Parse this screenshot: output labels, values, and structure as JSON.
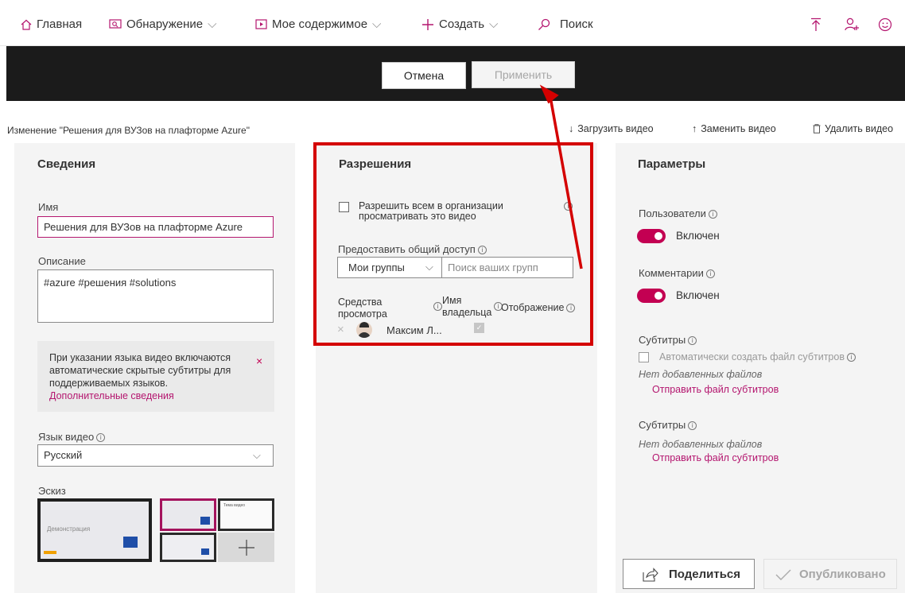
{
  "nav": {
    "home": "Главная",
    "discover": "Обнаружение",
    "my_content": "Мое содержимое",
    "create": "Создать",
    "search": "Поиск"
  },
  "actions": {
    "cancel": "Отмена",
    "apply": "Применить"
  },
  "toolbar": {
    "title": "Изменение \"Решения для ВУЗов на плафторме Azure\"",
    "upload": "Загрузить видео",
    "replace": "Заменить видео",
    "delete": "Удалить видео"
  },
  "details": {
    "header": "Сведения",
    "name_label": "Имя",
    "name_value": "Решения для ВУЗов на плафторме Azure",
    "desc_label": "Описание",
    "desc_value": "#azure #решения #solutions",
    "notice_text": "При указании языка видео включаются автоматические скрытые субтитры для поддерживаемых языков.",
    "notice_link": "Дополнительные сведения",
    "lang_label": "Язык видео",
    "lang_value": "Русский",
    "thumb_label": "Эскиз",
    "thumb1_text": "Демонстрация",
    "thumb3_text": "Тема видео"
  },
  "permissions": {
    "header": "Разрешения",
    "allow_label": "Разрешить всем в организации просматривать это видео",
    "share_label": "Предоставить общий доступ",
    "groups_value": "Мои группы",
    "search_placeholder": "Поиск ваших групп",
    "col_viewers": "Средства просмотра",
    "col_owner": "Имя владельца",
    "col_display": "Отображение",
    "row_name": "Максим Л..."
  },
  "settings": {
    "header": "Параметры",
    "users_label": "Пользователи",
    "users_state": "Включен",
    "comments_label": "Комментарии",
    "comments_state": "Включен",
    "subs1_label": "Субтитры",
    "auto_subs": "Автоматически создать файл субтитров",
    "no_files_1": "Нет добавленных файлов",
    "send_subs_1": "Отправить файл субтитров",
    "subs2_label": "Субтитры",
    "no_files_2": "Нет добавленных файлов",
    "send_subs_2": "Отправить файл субтитров"
  },
  "footer": {
    "share": "Поделиться",
    "published": "Опубликовано"
  },
  "colors": {
    "accent": "#c30052",
    "link": "#b4166f",
    "highlight": "#d40000",
    "dark_bar": "#1b1b1b"
  }
}
